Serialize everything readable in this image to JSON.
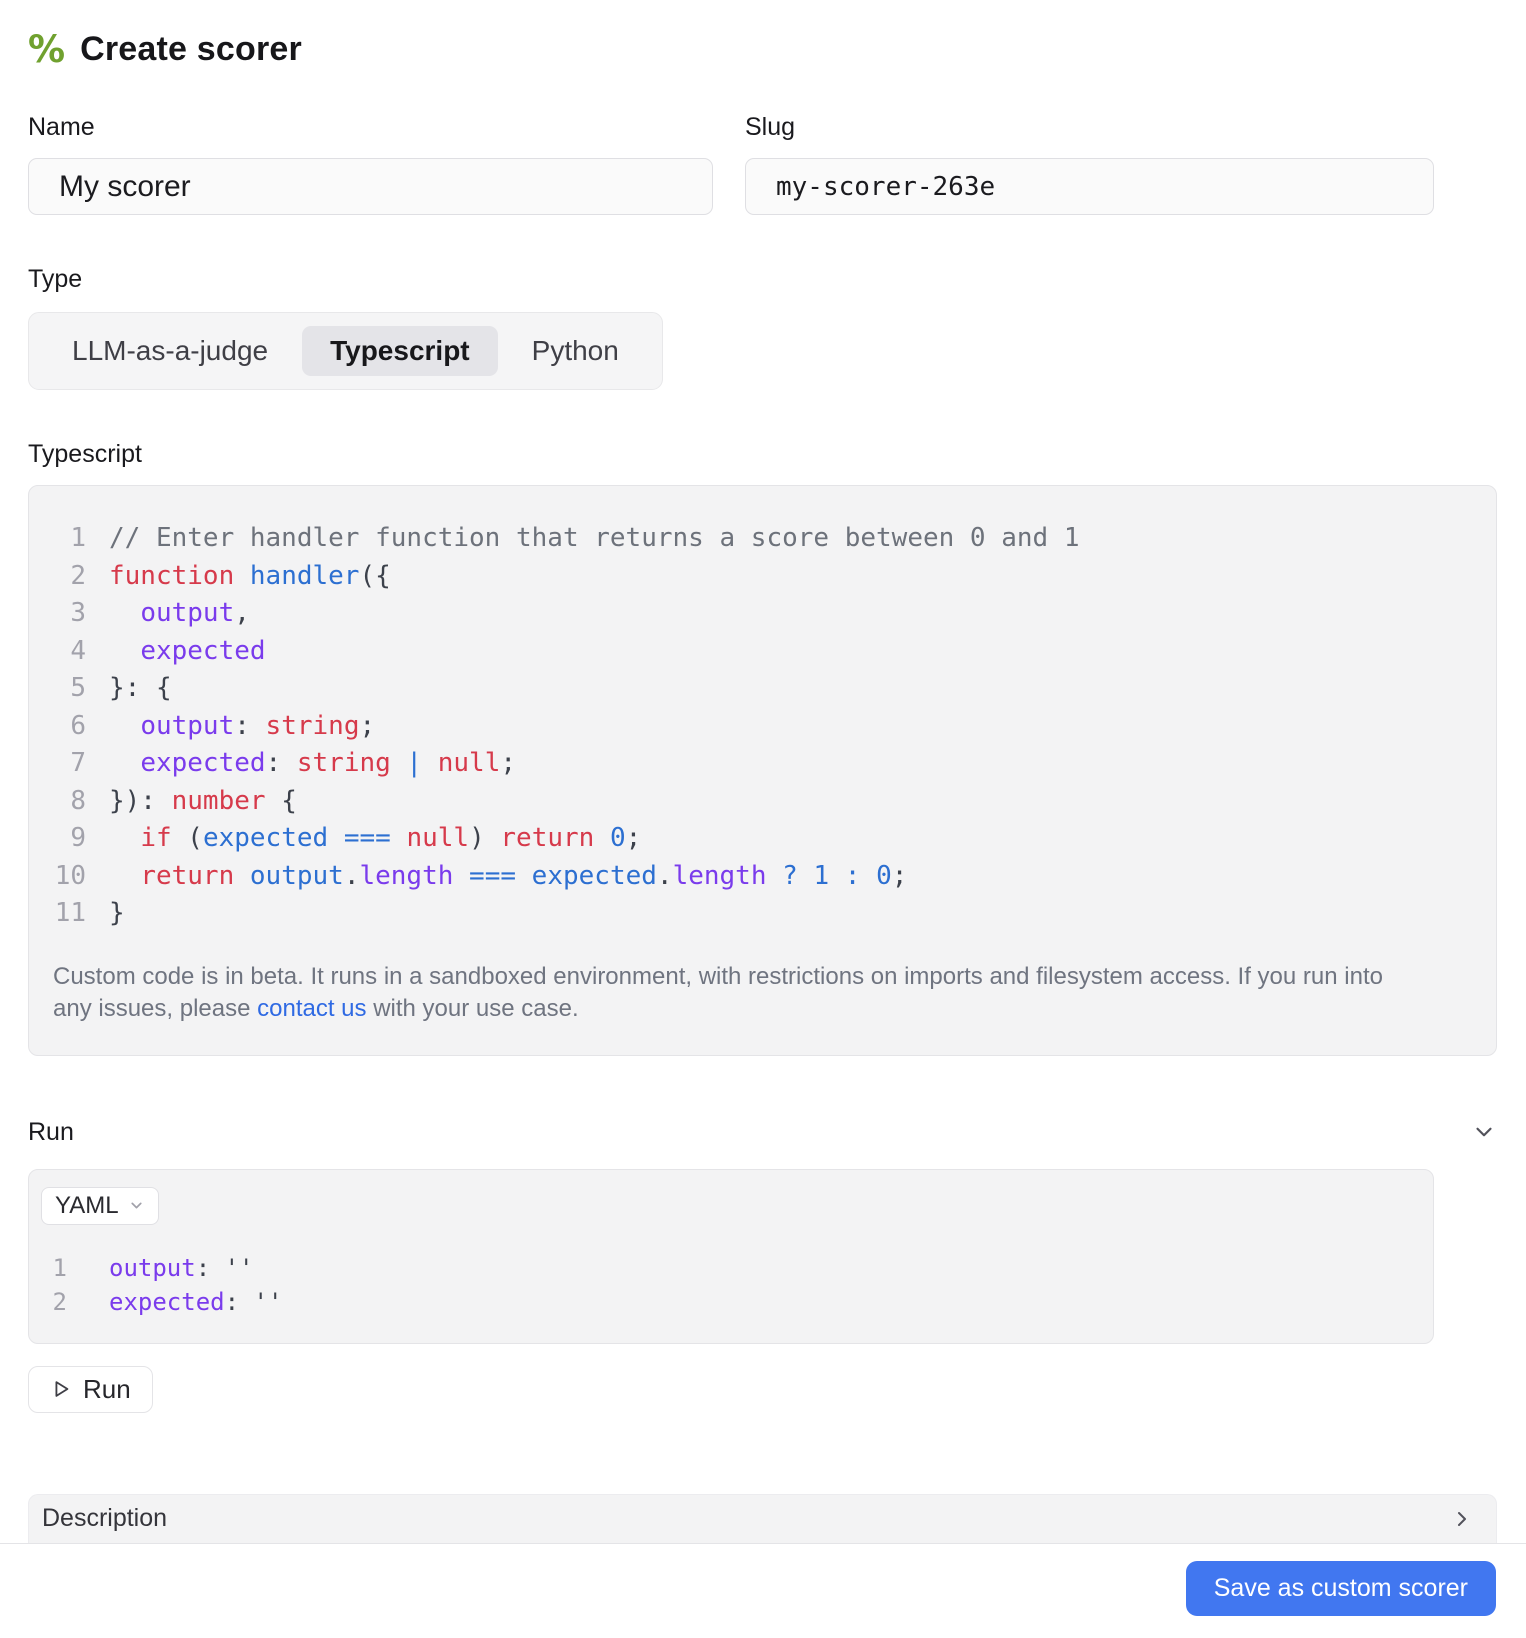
{
  "header": {
    "title": "Create scorer",
    "icon": "percent-icon",
    "icon_glyph": "%"
  },
  "fields": {
    "name": {
      "label": "Name",
      "value": "My scorer"
    },
    "slug": {
      "label": "Slug",
      "value": "my-scorer-263e"
    }
  },
  "type_selector": {
    "label": "Type",
    "options": [
      {
        "label": "LLM-as-a-judge",
        "selected": false
      },
      {
        "label": "Typescript",
        "selected": true
      },
      {
        "label": "Python",
        "selected": false
      }
    ]
  },
  "editor": {
    "label": "Typescript",
    "lines": [
      {
        "num": "1",
        "tokens": [
          [
            "comment",
            "// Enter handler function that returns a score between 0 and 1"
          ]
        ]
      },
      {
        "num": "2",
        "tokens": [
          [
            "kw",
            "function"
          ],
          [
            "plain",
            " "
          ],
          [
            "fn",
            "handler"
          ],
          [
            "punct",
            "({"
          ]
        ]
      },
      {
        "num": "3",
        "tokens": [
          [
            "plain",
            "  "
          ],
          [
            "prop",
            "output"
          ],
          [
            "punct",
            ","
          ]
        ]
      },
      {
        "num": "4",
        "tokens": [
          [
            "plain",
            "  "
          ],
          [
            "prop",
            "expected"
          ]
        ]
      },
      {
        "num": "5",
        "tokens": [
          [
            "punct",
            "}: {"
          ]
        ]
      },
      {
        "num": "6",
        "tokens": [
          [
            "plain",
            "  "
          ],
          [
            "prop",
            "output"
          ],
          [
            "punct",
            ": "
          ],
          [
            "kw",
            "string"
          ],
          [
            "punct",
            ";"
          ]
        ]
      },
      {
        "num": "7",
        "tokens": [
          [
            "plain",
            "  "
          ],
          [
            "prop",
            "expected"
          ],
          [
            "punct",
            ": "
          ],
          [
            "kw",
            "string"
          ],
          [
            "op",
            " | "
          ],
          [
            "kw",
            "null"
          ],
          [
            "punct",
            ";"
          ]
        ]
      },
      {
        "num": "8",
        "tokens": [
          [
            "punct",
            "}): "
          ],
          [
            "kw",
            "number"
          ],
          [
            "punct",
            " {"
          ]
        ]
      },
      {
        "num": "9",
        "tokens": [
          [
            "plain",
            "  "
          ],
          [
            "kw",
            "if"
          ],
          [
            "punct",
            " ("
          ],
          [
            "ident",
            "expected"
          ],
          [
            "op",
            " === "
          ],
          [
            "kw",
            "null"
          ],
          [
            "punct",
            ") "
          ],
          [
            "kw",
            "return"
          ],
          [
            "plain",
            " "
          ],
          [
            "num",
            "0"
          ],
          [
            "punct",
            ";"
          ]
        ]
      },
      {
        "num": "10",
        "tokens": [
          [
            "plain",
            "  "
          ],
          [
            "kw",
            "return"
          ],
          [
            "plain",
            " "
          ],
          [
            "ident",
            "output"
          ],
          [
            "punct",
            "."
          ],
          [
            "prop",
            "length"
          ],
          [
            "op",
            " === "
          ],
          [
            "ident",
            "expected"
          ],
          [
            "punct",
            "."
          ],
          [
            "prop",
            "length"
          ],
          [
            "op",
            " ? "
          ],
          [
            "num",
            "1"
          ],
          [
            "op",
            " : "
          ],
          [
            "num",
            "0"
          ],
          [
            "punct",
            ";"
          ]
        ]
      },
      {
        "num": "11",
        "tokens": [
          [
            "punct",
            "}"
          ]
        ]
      }
    ],
    "notice": {
      "before": "Custom code is in beta. It runs in a sandboxed environment, with restrictions on imports and filesystem access. If you run into any issues, please ",
      "link": "contact us",
      "after": " with your use case."
    }
  },
  "run": {
    "label": "Run",
    "format_selected": "YAML",
    "lines": [
      {
        "num": "1",
        "tokens": [
          [
            "prop",
            "output"
          ],
          [
            "punct",
            ": "
          ],
          [
            "str",
            "''"
          ]
        ]
      },
      {
        "num": "2",
        "tokens": [
          [
            "prop",
            "expected"
          ],
          [
            "punct",
            ": "
          ],
          [
            "str",
            "''"
          ]
        ]
      }
    ],
    "run_button": "Run"
  },
  "description": {
    "label": "Description"
  },
  "footer": {
    "save_button": "Save as custom scorer"
  },
  "colors": {
    "accent_blue": "#4177f0",
    "icon_green": "#70a12f",
    "link_blue": "#2f6ae3",
    "keyword_red": "#d63a4b",
    "identifier_blue": "#2c6fd1",
    "property_purple": "#7a3bec"
  }
}
